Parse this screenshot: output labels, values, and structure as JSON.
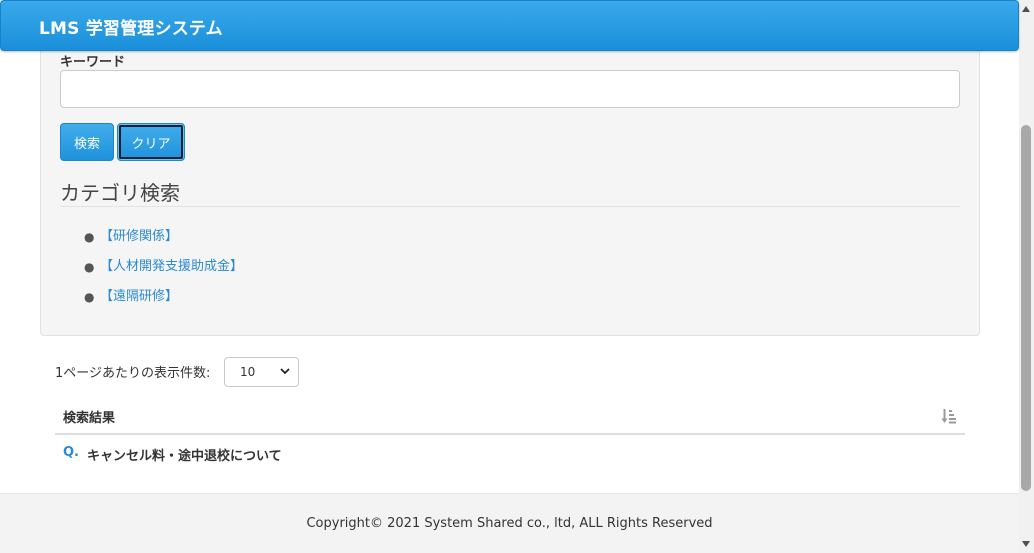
{
  "header": {
    "title": "LMS 学習管理システム"
  },
  "search": {
    "keyword_label": "キーワード",
    "keyword_value": "",
    "search_button": "検索",
    "clear_button": "クリア"
  },
  "category": {
    "heading": "カテゴリ検索",
    "items": [
      {
        "label": "【研修関係】"
      },
      {
        "label": "【人材開発支援助成金】"
      },
      {
        "label": "【遠隔研修】"
      }
    ]
  },
  "pagination": {
    "per_page_label": "1ページあたりの表示件数:",
    "per_page_value": "10"
  },
  "results": {
    "title": "検索結果",
    "sort_icon": "sort-amount-down-icon",
    "rows": [
      {
        "prefix": "Q.",
        "text": "キャンセル料・途中退校について"
      }
    ]
  },
  "footer": {
    "copyright": "Copyright© 2021 System Shared co., ltd, ALL Rights Reserved"
  },
  "colors": {
    "header_bg": "#2a9de5",
    "link": "#2a8ad4",
    "button_bg": "#2b9ae2",
    "panel_bg": "#f5f5f5"
  }
}
